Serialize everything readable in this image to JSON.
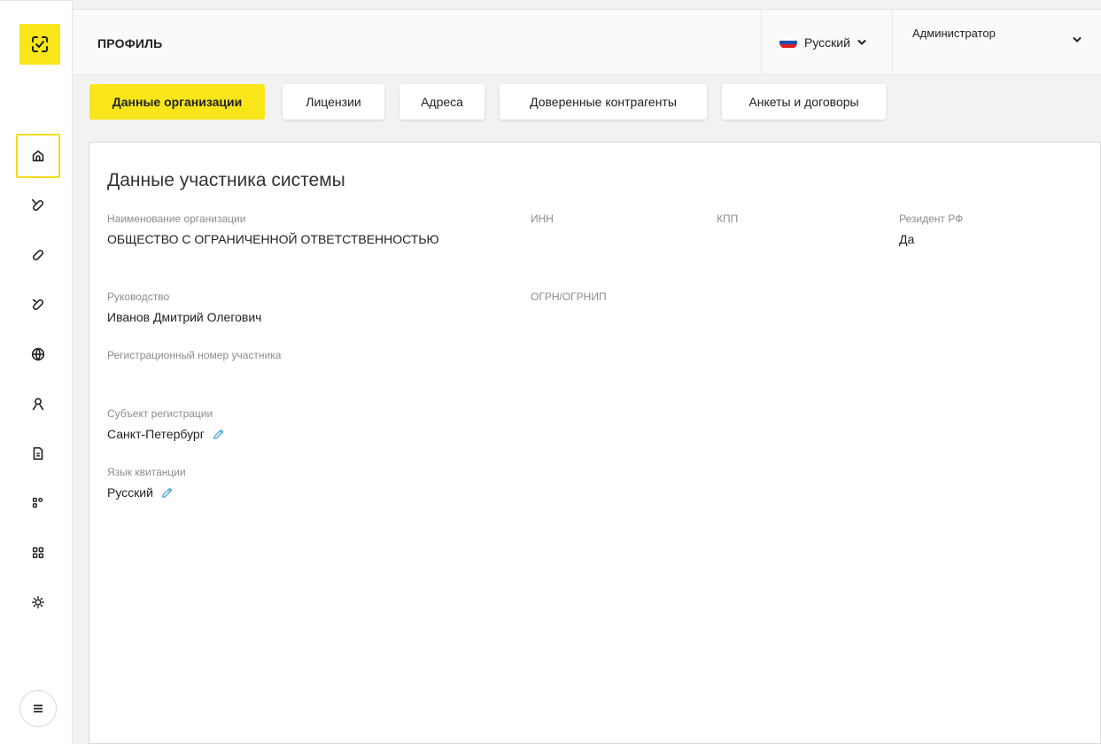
{
  "header": {
    "title": "ПРОФИЛЬ",
    "language": "Русский",
    "user": "Администратор"
  },
  "sidebar": {
    "items": [
      {
        "icon": "home-icon",
        "active": true
      },
      {
        "icon": "pill-slash-icon"
      },
      {
        "icon": "pill-icon"
      },
      {
        "icon": "pill-off-icon"
      },
      {
        "icon": "globe-icon"
      },
      {
        "icon": "user-icon"
      },
      {
        "icon": "document-icon"
      },
      {
        "icon": "modules-icon"
      },
      {
        "icon": "grid-icon"
      },
      {
        "icon": "settings-gear-icon"
      }
    ],
    "menu_icon": "hamburger-menu-icon"
  },
  "tabs": [
    {
      "label": "Данные организации",
      "active": true
    },
    {
      "label": "Лицензии"
    },
    {
      "label": "Адреса"
    },
    {
      "label": "Доверенные контрагенты"
    },
    {
      "label": "Анкеты и договоры"
    }
  ],
  "card": {
    "title": "Данные участника системы",
    "fields": {
      "org_name": {
        "label": "Наименование организации",
        "value": "ОБЩЕСТВО С ОГРАНИЧЕННОЙ ОТВЕТСТВЕННОСТЬЮ"
      },
      "inn": {
        "label": "ИНН",
        "value": ""
      },
      "kpp": {
        "label": "КПП",
        "value": ""
      },
      "resident": {
        "label": "Резидент РФ",
        "value": "Да"
      },
      "director": {
        "label": "Руководство",
        "value": "Иванов Дмитрий Олегович"
      },
      "ogrn": {
        "label": "ОГРН/ОГРНИП",
        "value": ""
      },
      "reg_number": {
        "label": "Регистрационный номер участника",
        "value": ""
      },
      "region": {
        "label": "Субъект регистрации",
        "value": "Санкт-Петербург"
      },
      "receipt_lang": {
        "label": "Язык квитанции",
        "value": "Русский"
      }
    }
  },
  "colors": {
    "accent": "#f8e51a",
    "edit_icon": "#4aa8d8",
    "label": "#8c8c8c"
  }
}
